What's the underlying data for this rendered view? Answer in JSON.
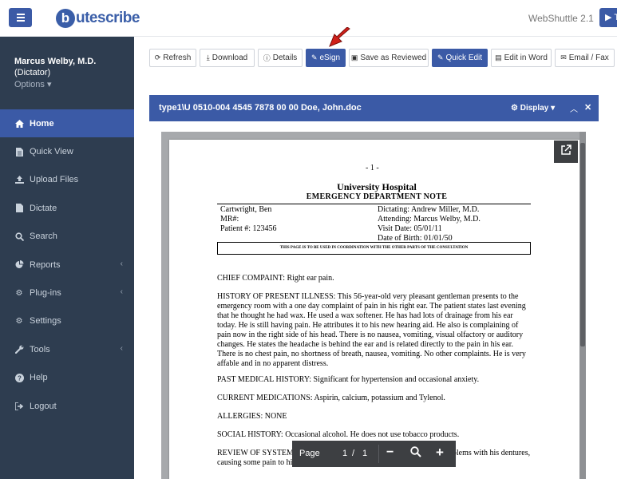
{
  "header": {
    "logo_letter": "b",
    "logo_text": "utescribe",
    "app_name": "WebShuttle 2.1",
    "right_button_label": "T"
  },
  "user": {
    "name": "Marcus Welby, M.D.",
    "role": "(Dictator)",
    "options_label": "Options"
  },
  "sidebar": {
    "items": [
      {
        "label": "Home",
        "icon": "home-icon",
        "active": true
      },
      {
        "label": "Quick View",
        "icon": "document-icon"
      },
      {
        "label": "Upload Files",
        "icon": "upload-icon"
      },
      {
        "label": "Dictate",
        "icon": "file-icon"
      },
      {
        "label": "Search",
        "icon": "search-icon"
      },
      {
        "label": "Reports",
        "icon": "pie-chart-icon",
        "has_submenu": true
      },
      {
        "label": "Plug-ins",
        "icon": "gears-icon",
        "has_submenu": true
      },
      {
        "label": "Settings",
        "icon": "gear-icon"
      },
      {
        "label": "Tools",
        "icon": "wrench-icon",
        "has_submenu": true
      },
      {
        "label": "Help",
        "icon": "help-icon"
      },
      {
        "label": "Logout",
        "icon": "sign-out-icon"
      }
    ]
  },
  "toolbar": {
    "refresh": "Refresh",
    "download": "Download",
    "details": "Details",
    "esign": "eSign",
    "save_reviewed": "Save as Reviewed",
    "quick_edit": "Quick Edit",
    "edit_word": "Edit in Word",
    "email_fax": "Email / Fax"
  },
  "document": {
    "title": "type1\\U 0510-004 4545 7878 00 00 Doe, John.doc",
    "display_label": "Display",
    "page": {
      "page_number": "- 1 -",
      "hospital": "University Hospital",
      "department": "EMERGENCY DEPARTMENT NOTE",
      "left_block": [
        "Cartwright, Ben",
        "MR#:",
        "Patient #:   123456"
      ],
      "right_block": [
        "Dictating:  Andrew Miller, M.D.",
        "Attending:  Marcus Welby, M.D.",
        "Visit Date:  05/01/11",
        "Date of Birth:   01/01/50"
      ],
      "notice": "THIS PAGE IS TO BE USED IN COORDINATION WITH THE OTHER PARTS OF THE CONSULTATION",
      "chief_complaint": "CHIEF COMPAINT:  Right ear pain.",
      "history": "HISTORY OF PRESENT ILLNESS:  This 56-year-old very pleasant gentleman presents to the emergency room with a one day complaint of pain in his right ear. The patient states last evening that he thought he had wax.  He used a wax softener.  He has had lots of drainage from his ear today.  He is still having pain.  He attributes it to his new hearing aid.  He also is complaining of pain now in the right side of his head.  There is no nausea, vomiting, visual olfactory or auditory changes. He states the headache is behind the ear and is related directly to the pain in his ear. There is no chest pain, no shortness of breath, nausea, vomiting. No other complaints. He is very affable and in no apparent distress.",
      "past_medical": "PAST MEDICAL HISTORY:  Significant for hypertension and occasional anxiety.",
      "medications": "CURRENT MEDICATIONS:  Aspirin, calcium, potassium and Tylenol.",
      "allergies": "ALLERGIES: NONE",
      "social": "SOCIAL HISTORY:  Occasional alcohol. He does not use tobacco products.",
      "review": "REVIEW OF SYSTEMS: The patient states he has been having some problems with his dentures, causing some pain to his gums. He is seeing a dentist for this problem."
    }
  },
  "page_controls": {
    "label": "Page",
    "current": "1",
    "separator": "/",
    "total": "1"
  },
  "colors": {
    "accent": "#3b5aa6",
    "sidebar_bg": "#2e3d50",
    "annotation_arrow": "#d0201a"
  }
}
